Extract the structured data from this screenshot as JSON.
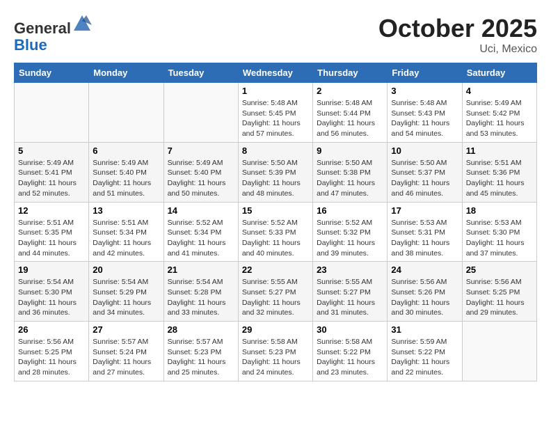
{
  "header": {
    "logo_general": "General",
    "logo_blue": "Blue",
    "month_title": "October 2025",
    "location": "Uci, Mexico"
  },
  "days_of_week": [
    "Sunday",
    "Monday",
    "Tuesday",
    "Wednesday",
    "Thursday",
    "Friday",
    "Saturday"
  ],
  "weeks": [
    [
      {
        "day": "",
        "info": ""
      },
      {
        "day": "",
        "info": ""
      },
      {
        "day": "",
        "info": ""
      },
      {
        "day": "1",
        "info": "Sunrise: 5:48 AM\nSunset: 5:45 PM\nDaylight: 11 hours\nand 57 minutes."
      },
      {
        "day": "2",
        "info": "Sunrise: 5:48 AM\nSunset: 5:44 PM\nDaylight: 11 hours\nand 56 minutes."
      },
      {
        "day": "3",
        "info": "Sunrise: 5:48 AM\nSunset: 5:43 PM\nDaylight: 11 hours\nand 54 minutes."
      },
      {
        "day": "4",
        "info": "Sunrise: 5:49 AM\nSunset: 5:42 PM\nDaylight: 11 hours\nand 53 minutes."
      }
    ],
    [
      {
        "day": "5",
        "info": "Sunrise: 5:49 AM\nSunset: 5:41 PM\nDaylight: 11 hours\nand 52 minutes."
      },
      {
        "day": "6",
        "info": "Sunrise: 5:49 AM\nSunset: 5:40 PM\nDaylight: 11 hours\nand 51 minutes."
      },
      {
        "day": "7",
        "info": "Sunrise: 5:49 AM\nSunset: 5:40 PM\nDaylight: 11 hours\nand 50 minutes."
      },
      {
        "day": "8",
        "info": "Sunrise: 5:50 AM\nSunset: 5:39 PM\nDaylight: 11 hours\nand 48 minutes."
      },
      {
        "day": "9",
        "info": "Sunrise: 5:50 AM\nSunset: 5:38 PM\nDaylight: 11 hours\nand 47 minutes."
      },
      {
        "day": "10",
        "info": "Sunrise: 5:50 AM\nSunset: 5:37 PM\nDaylight: 11 hours\nand 46 minutes."
      },
      {
        "day": "11",
        "info": "Sunrise: 5:51 AM\nSunset: 5:36 PM\nDaylight: 11 hours\nand 45 minutes."
      }
    ],
    [
      {
        "day": "12",
        "info": "Sunrise: 5:51 AM\nSunset: 5:35 PM\nDaylight: 11 hours\nand 44 minutes."
      },
      {
        "day": "13",
        "info": "Sunrise: 5:51 AM\nSunset: 5:34 PM\nDaylight: 11 hours\nand 42 minutes."
      },
      {
        "day": "14",
        "info": "Sunrise: 5:52 AM\nSunset: 5:34 PM\nDaylight: 11 hours\nand 41 minutes."
      },
      {
        "day": "15",
        "info": "Sunrise: 5:52 AM\nSunset: 5:33 PM\nDaylight: 11 hours\nand 40 minutes."
      },
      {
        "day": "16",
        "info": "Sunrise: 5:52 AM\nSunset: 5:32 PM\nDaylight: 11 hours\nand 39 minutes."
      },
      {
        "day": "17",
        "info": "Sunrise: 5:53 AM\nSunset: 5:31 PM\nDaylight: 11 hours\nand 38 minutes."
      },
      {
        "day": "18",
        "info": "Sunrise: 5:53 AM\nSunset: 5:30 PM\nDaylight: 11 hours\nand 37 minutes."
      }
    ],
    [
      {
        "day": "19",
        "info": "Sunrise: 5:54 AM\nSunset: 5:30 PM\nDaylight: 11 hours\nand 36 minutes."
      },
      {
        "day": "20",
        "info": "Sunrise: 5:54 AM\nSunset: 5:29 PM\nDaylight: 11 hours\nand 34 minutes."
      },
      {
        "day": "21",
        "info": "Sunrise: 5:54 AM\nSunset: 5:28 PM\nDaylight: 11 hours\nand 33 minutes."
      },
      {
        "day": "22",
        "info": "Sunrise: 5:55 AM\nSunset: 5:27 PM\nDaylight: 11 hours\nand 32 minutes."
      },
      {
        "day": "23",
        "info": "Sunrise: 5:55 AM\nSunset: 5:27 PM\nDaylight: 11 hours\nand 31 minutes."
      },
      {
        "day": "24",
        "info": "Sunrise: 5:56 AM\nSunset: 5:26 PM\nDaylight: 11 hours\nand 30 minutes."
      },
      {
        "day": "25",
        "info": "Sunrise: 5:56 AM\nSunset: 5:25 PM\nDaylight: 11 hours\nand 29 minutes."
      }
    ],
    [
      {
        "day": "26",
        "info": "Sunrise: 5:56 AM\nSunset: 5:25 PM\nDaylight: 11 hours\nand 28 minutes."
      },
      {
        "day": "27",
        "info": "Sunrise: 5:57 AM\nSunset: 5:24 PM\nDaylight: 11 hours\nand 27 minutes."
      },
      {
        "day": "28",
        "info": "Sunrise: 5:57 AM\nSunset: 5:23 PM\nDaylight: 11 hours\nand 25 minutes."
      },
      {
        "day": "29",
        "info": "Sunrise: 5:58 AM\nSunset: 5:23 PM\nDaylight: 11 hours\nand 24 minutes."
      },
      {
        "day": "30",
        "info": "Sunrise: 5:58 AM\nSunset: 5:22 PM\nDaylight: 11 hours\nand 23 minutes."
      },
      {
        "day": "31",
        "info": "Sunrise: 5:59 AM\nSunset: 5:22 PM\nDaylight: 11 hours\nand 22 minutes."
      },
      {
        "day": "",
        "info": ""
      }
    ]
  ]
}
